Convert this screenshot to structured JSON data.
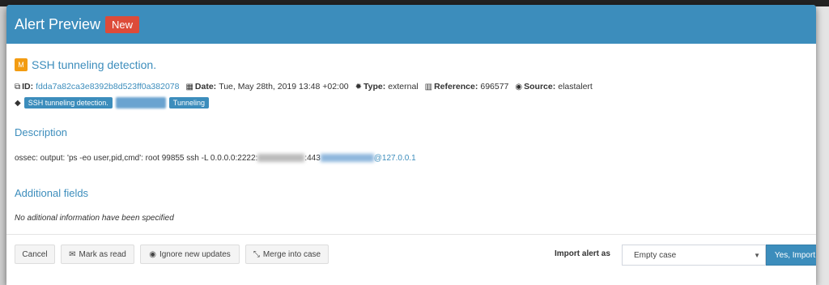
{
  "modal": {
    "title": "Alert Preview",
    "badge": "New"
  },
  "alert": {
    "severity_letter": "M",
    "title": "SSH tunneling detection.",
    "id_label": "ID:",
    "id_value": "fdda7a82ca3e8392b8d523ff0a382078",
    "date_label": "Date:",
    "date_value": "Tue, May 28th, 2019 13:48 +02:00",
    "type_label": "Type:",
    "type_value": "external",
    "reference_label": "Reference:",
    "reference_value": "696577",
    "source_label": "Source:",
    "source_value": "elastalert",
    "tags": [
      "SSH tunneling detection.",
      "",
      "Tunneling"
    ]
  },
  "description": {
    "heading": "Description",
    "text_prefix": "ossec: output: 'ps -eo user,pid,cmd': root 99855 ssh -L 0.0.0.0:2222:",
    "text_mid": ":443",
    "text_suffix": "@127.0.0.1"
  },
  "additional": {
    "heading": "Additional fields",
    "empty_text": "No aditional information have been specified"
  },
  "footer": {
    "cancel": "Cancel",
    "mark_read": "Mark as read",
    "ignore_updates": "Ignore new updates",
    "merge": "Merge into case",
    "import_label": "Import alert as",
    "import_select_value": "Empty case",
    "import_button": "Yes, Import"
  },
  "colors": {
    "header": "#3c8dbc",
    "badge_new": "#dd4b39",
    "severity_medium": "#f39c12"
  }
}
